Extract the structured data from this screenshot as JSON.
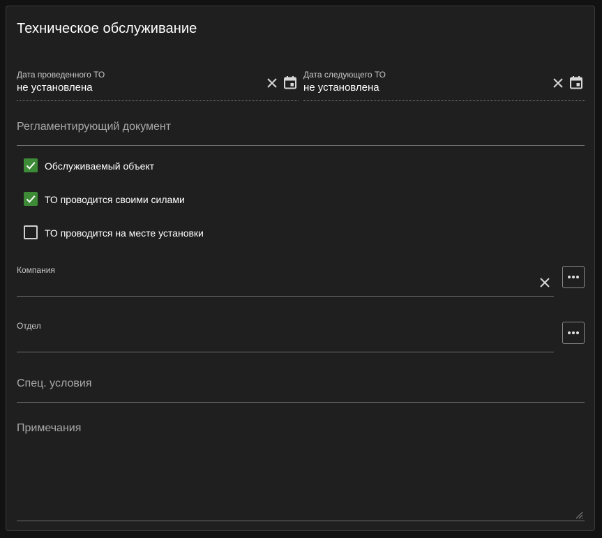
{
  "panel": {
    "title": "Техническое обслуживание"
  },
  "last_service": {
    "label": "Дата проведенного ТО",
    "value": "не установлена"
  },
  "next_service": {
    "label": "Дата следующего ТО",
    "value": "не установлена"
  },
  "regulating_document": {
    "placeholder": "Регламентирующий документ"
  },
  "checkboxes": [
    {
      "label": "Обслуживаемый объект",
      "checked": true
    },
    {
      "label": "ТО проводится своими силами",
      "checked": true
    },
    {
      "label": "ТО проводится на месте установки",
      "checked": false
    }
  ],
  "company": {
    "label": "Компания",
    "value": ""
  },
  "department": {
    "label": "Отдел",
    "value": ""
  },
  "special_conditions": {
    "placeholder": "Спец. условия"
  },
  "notes": {
    "placeholder": "Примечания"
  },
  "colors": {
    "accent_check": "#3d8b37",
    "background": "#1f1f1f",
    "text": "#ffffff"
  }
}
